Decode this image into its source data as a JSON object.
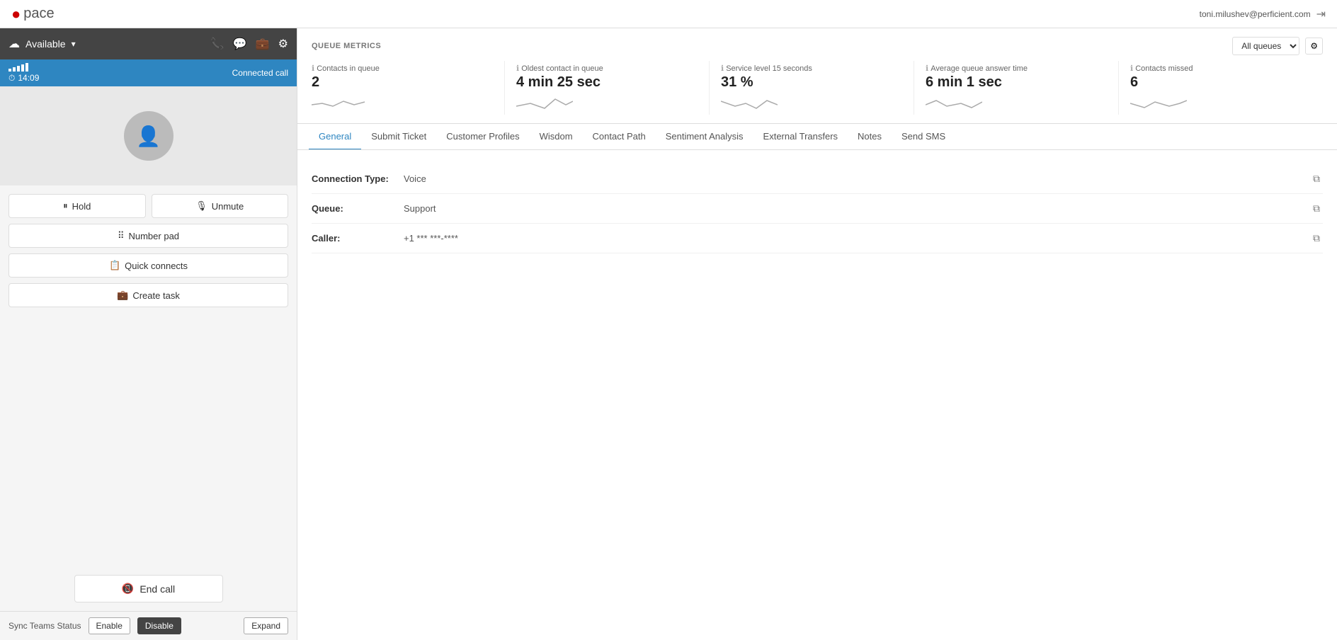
{
  "app": {
    "logo_icon": "●",
    "logo_text": "pace",
    "user_email": "toni.milushev@perficient.com",
    "logout_icon": "⇥"
  },
  "status_bar": {
    "cloud_icon": "☁",
    "status": "Available",
    "chevron": "▾",
    "icons": [
      "📞",
      "💬",
      "💼",
      "⚙"
    ]
  },
  "call_bar": {
    "timer_icon": "⏱",
    "timer": "14:09",
    "status": "Connected call"
  },
  "controls": {
    "hold_label": "Hold",
    "unmute_label": "Unmute",
    "number_pad_label": "Number pad",
    "quick_connects_label": "Quick connects",
    "create_task_label": "Create task",
    "end_call_label": "End call"
  },
  "sync": {
    "label": "Sync Teams Status",
    "enable_label": "Enable",
    "disable_label": "Disable",
    "expand_label": "Expand"
  },
  "queue_metrics": {
    "title": "QUEUE METRICS",
    "select_placeholder": "All queues",
    "metrics": [
      {
        "label": "Contacts in queue",
        "value": "2"
      },
      {
        "label": "Oldest contact in queue",
        "value": "4 min 25 sec"
      },
      {
        "label": "Service level 15 seconds",
        "value": "31 %"
      },
      {
        "label": "Average queue answer time",
        "value": "6 min 1 sec"
      },
      {
        "label": "Contacts missed",
        "value": "6"
      }
    ]
  },
  "tabs": [
    {
      "id": "general",
      "label": "General",
      "active": true
    },
    {
      "id": "submit-ticket",
      "label": "Submit Ticket",
      "active": false
    },
    {
      "id": "customer-profiles",
      "label": "Customer Profiles",
      "active": false
    },
    {
      "id": "wisdom",
      "label": "Wisdom",
      "active": false
    },
    {
      "id": "contact-path",
      "label": "Contact Path",
      "active": false
    },
    {
      "id": "sentiment-analysis",
      "label": "Sentiment Analysis",
      "active": false
    },
    {
      "id": "external-transfers",
      "label": "External Transfers",
      "active": false
    },
    {
      "id": "notes",
      "label": "Notes",
      "active": false
    },
    {
      "id": "send-sms",
      "label": "Send SMS",
      "active": false
    }
  ],
  "general": {
    "connection_type_label": "Connection Type:",
    "connection_type_value": "Voice",
    "queue_label": "Queue:",
    "queue_value": "Support",
    "caller_label": "Caller:",
    "caller_value": "+1 *** ***-****"
  }
}
